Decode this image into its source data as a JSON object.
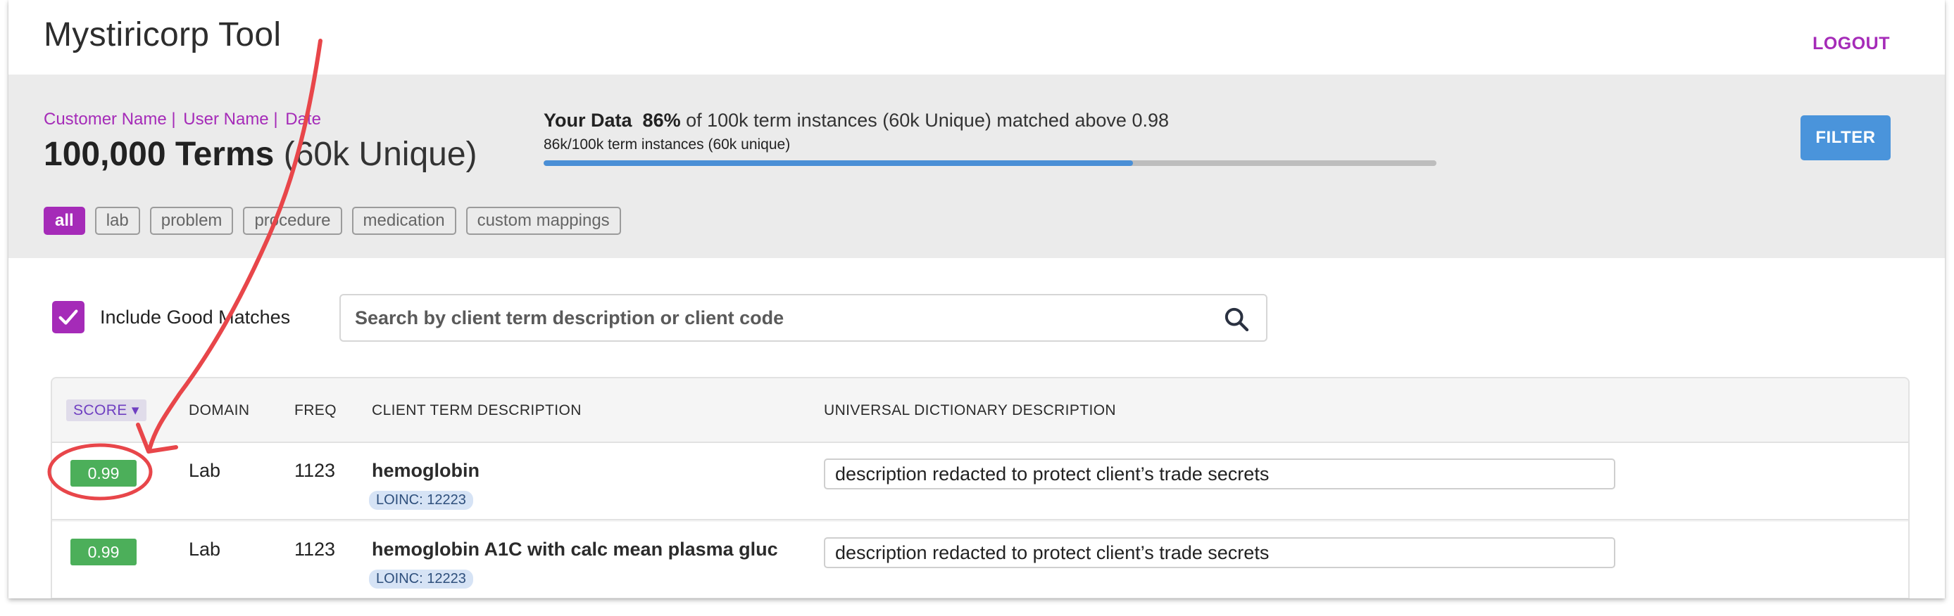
{
  "app": {
    "title": "Mystiricorp Tool",
    "logout_label": "LOGOUT"
  },
  "summary": {
    "meta": [
      "Customer Name |",
      "User Name |",
      "Date"
    ],
    "terms_bold": "100,000 Terms",
    "terms_unique": "(60k Unique)",
    "data_label": "Your Data",
    "data_percent": "86%",
    "data_rest": "of 100k term instances (60k Unique)  matched above 0.98",
    "data_sub": "86k/100k term instances (60k unique)",
    "progress_fraction": 0.66,
    "filter_label": "FILTER",
    "chips": [
      {
        "label": "all",
        "active": true
      },
      {
        "label": "lab",
        "active": false
      },
      {
        "label": "problem",
        "active": false
      },
      {
        "label": "procedure",
        "active": false
      },
      {
        "label": "medication",
        "active": false
      },
      {
        "label": "custom mappings",
        "active": false
      }
    ]
  },
  "controls": {
    "include_label": "Include Good Matches",
    "include_checked": true,
    "search_placeholder": "Search by client term description or client code"
  },
  "table": {
    "headers": {
      "score": "SCORE ▾",
      "domain": "DOMAIN",
      "freq": "FREQ",
      "client_desc": "CLIENT TERM DESCRIPTION",
      "universal_desc": "UNIVERSAL DICTIONARY DESCRIPTION"
    },
    "rows": [
      {
        "score": "0.99",
        "domain": "Lab",
        "freq": "1123",
        "client_desc": "hemoglobin",
        "code": "LOINC: 12223",
        "universal_desc": "description redacted to protect client’s trade secrets"
      },
      {
        "score": "0.99",
        "domain": "Lab",
        "freq": "1123",
        "client_desc": "hemoglobin A1C with calc mean plasma gluc",
        "code": "LOINC: 12223",
        "universal_desc": "description redacted to protect client’s trade secrets"
      }
    ]
  },
  "colors": {
    "accent": "#a52bb8",
    "primary": "#4a94db",
    "score_good": "#4caf5a",
    "annotation": "#e8464a"
  }
}
